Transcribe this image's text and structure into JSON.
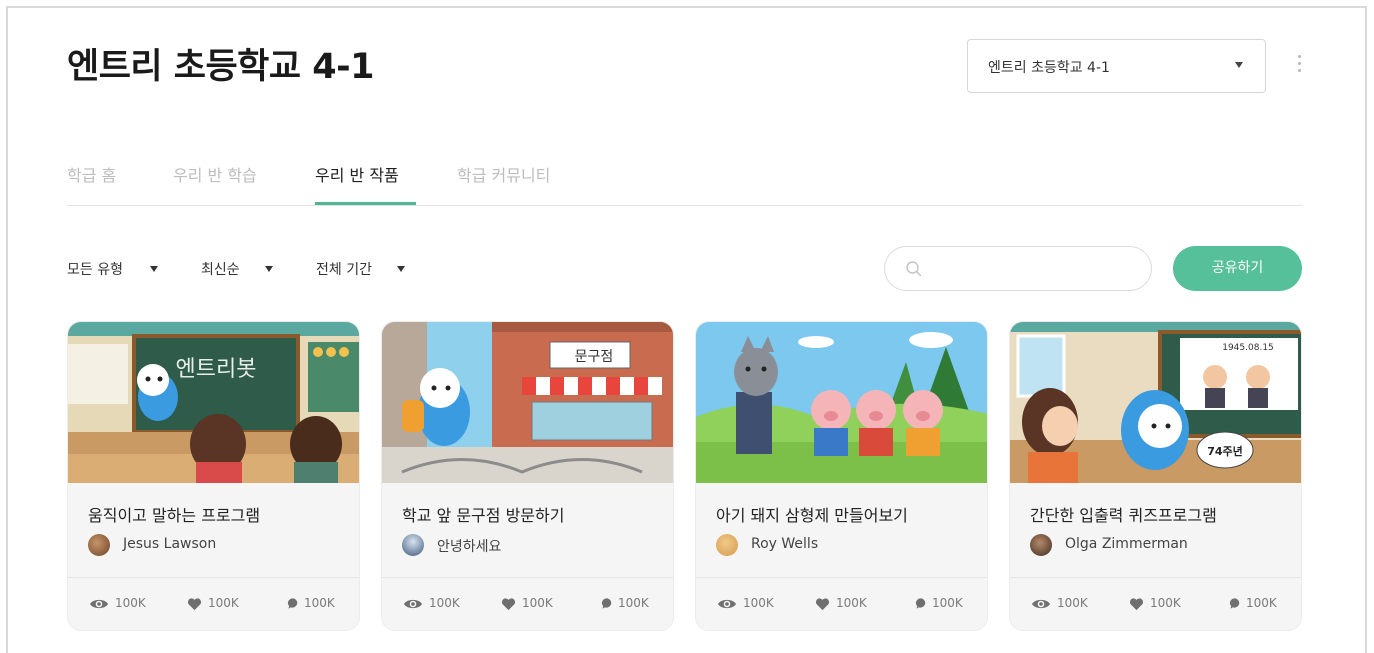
{
  "page": {
    "title": "엔트리 초등학교 4-1"
  },
  "class_select": {
    "value": "엔트리 초등학교 4-1"
  },
  "tabs": [
    {
      "label": "학급 홈",
      "active": false
    },
    {
      "label": "우리 반 학습",
      "active": false
    },
    {
      "label": "우리 반 작품",
      "active": true
    },
    {
      "label": "학급 커뮤니티",
      "active": false
    }
  ],
  "filters": [
    {
      "label": "모든 유형"
    },
    {
      "label": "최신순"
    },
    {
      "label": "전체 기간"
    }
  ],
  "search": {
    "placeholder": ""
  },
  "share_button": {
    "label": "공유하기"
  },
  "accent_color": "#55c09a",
  "cards": [
    {
      "title": "움직이고 말하는 프로그램",
      "thumb_text": "엔트리봇",
      "author": "Jesus Lawson",
      "views": "100K",
      "likes": "100K",
      "comments": "100K"
    },
    {
      "title": "학교 앞 문구점 방문하기",
      "thumb_text": "문구점",
      "author": "안녕하세요",
      "views": "100K",
      "likes": "100K",
      "comments": "100K"
    },
    {
      "title": "아기 돼지 삼형제 만들어보기",
      "author": "Roy Wells",
      "views": "100K",
      "likes": "100K",
      "comments": "100K"
    },
    {
      "title": "간단한 입출력 퀴즈프로그램",
      "thumb_text": "74주년",
      "thumb_date": "1945.08.15",
      "author": "Olga Zimmerman",
      "views": "100K",
      "likes": "100K",
      "comments": "100K"
    }
  ]
}
